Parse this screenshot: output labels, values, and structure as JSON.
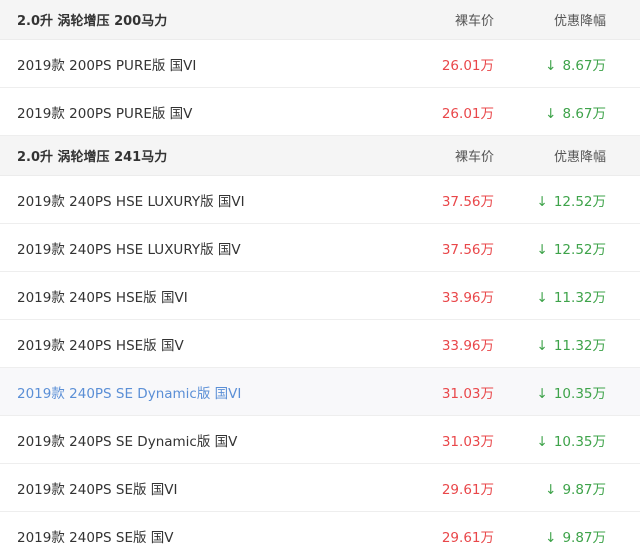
{
  "groups": [
    {
      "engine": "2.0升 涡轮增压 200马力",
      "price_header": "裸车价",
      "discount_header": "优惠降幅",
      "rows": [
        {
          "model": "2019款 200PS PURE版 国VI",
          "price": "26.01万",
          "discount": "8.67万"
        },
        {
          "model": "2019款 200PS PURE版 国V",
          "price": "26.01万",
          "discount": "8.67万"
        }
      ]
    },
    {
      "engine": "2.0升 涡轮增压 241马力",
      "price_header": "裸车价",
      "discount_header": "优惠降幅",
      "rows": [
        {
          "model": "2019款 240PS HSE LUXURY版 国VI",
          "price": "37.56万",
          "discount": "12.52万"
        },
        {
          "model": "2019款 240PS HSE LUXURY版 国V",
          "price": "37.56万",
          "discount": "12.52万"
        },
        {
          "model": "2019款 240PS HSE版 国VI",
          "price": "33.96万",
          "discount": "11.32万"
        },
        {
          "model": "2019款 240PS HSE版 国V",
          "price": "33.96万",
          "discount": "11.32万"
        },
        {
          "model": "2019款 240PS SE Dynamic版 国VI",
          "price": "31.03万",
          "discount": "10.35万"
        },
        {
          "model": "2019款 240PS SE Dynamic版 国V",
          "price": "31.03万",
          "discount": "10.35万"
        },
        {
          "model": "2019款 240PS SE版 国VI",
          "price": "29.61万",
          "discount": "9.87万"
        },
        {
          "model": "2019款 240PS SE版 国V",
          "price": "29.61万",
          "discount": "9.87万"
        }
      ]
    }
  ],
  "icons": {
    "down_arrow": "arrow-down-icon"
  },
  "colors": {
    "price": "#e9474a",
    "discount": "#3ea34a",
    "link_hover": "#5b8fd6",
    "header_bg": "#f5f5f5"
  }
}
